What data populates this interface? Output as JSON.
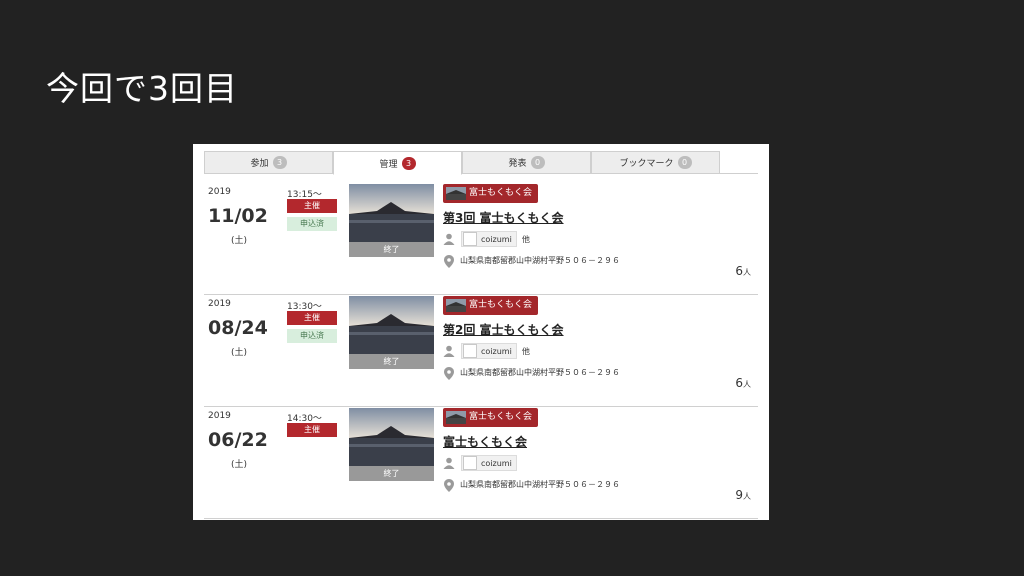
{
  "slide": {
    "title": "今回で3回目"
  },
  "tabs": [
    {
      "label": "参加",
      "count": "3",
      "active": false
    },
    {
      "label": "管理",
      "count": "3",
      "active": true
    },
    {
      "label": "発表",
      "count": "0",
      "active": false
    },
    {
      "label": "ブックマーク",
      "count": "0",
      "active": false
    }
  ],
  "events": [
    {
      "year": "2019",
      "date": "11/02",
      "dow": "(土)",
      "time": "13:15〜",
      "badge_host": "主催",
      "badge_applied": "申込済",
      "thumb_caption": "終了",
      "group": "富士もくもく会",
      "title": "第3回 富士もくもく会",
      "user": "coizumi",
      "others": "他",
      "address": "山梨県南都留郡山中湖村平野５０６－２９６",
      "count": "6",
      "count_unit": "人"
    },
    {
      "year": "2019",
      "date": "08/24",
      "dow": "(土)",
      "time": "13:30〜",
      "badge_host": "主催",
      "badge_applied": "申込済",
      "thumb_caption": "終了",
      "group": "富士もくもく会",
      "title": "第2回 富士もくもく会",
      "user": "coizumi",
      "others": "他",
      "address": "山梨県南都留郡山中湖村平野５０６－２９６",
      "count": "6",
      "count_unit": "人"
    },
    {
      "year": "2019",
      "date": "06/22",
      "dow": "(土)",
      "time": "14:30〜",
      "badge_host": "主催",
      "badge_applied": "",
      "thumb_caption": "終了",
      "group": "富士もくもく会",
      "title": "富士もくもく会",
      "user": "coizumi",
      "others": "",
      "address": "山梨県南都留郡山中湖村平野５０６－２９６",
      "count": "9",
      "count_unit": "人"
    }
  ],
  "colors": {
    "accent": "#b3282d",
    "background": "#222222",
    "panel": "#ffffff",
    "applied_bg": "#d8eedd"
  },
  "icons": {
    "user": "person-icon",
    "location": "map-pin-icon"
  }
}
